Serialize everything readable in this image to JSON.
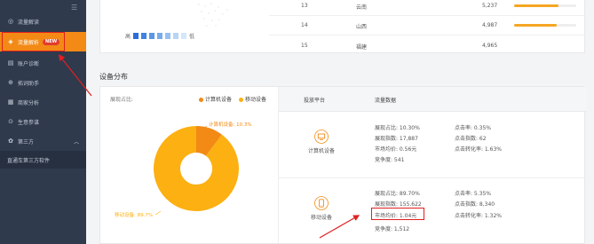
{
  "sidebar": {
    "collapse_icon": "list-icon",
    "items": [
      {
        "label": "流量解读",
        "icon": "analysis-icon"
      },
      {
        "label": "流量解析",
        "icon": "traffic-icon",
        "badge": "NEW"
      },
      {
        "label": "账户诊断",
        "icon": "diagnosis-icon"
      },
      {
        "label": "拓词助手",
        "icon": "keyword-icon"
      },
      {
        "label": "商家分析",
        "icon": "shop-icon"
      },
      {
        "label": "生意参谋",
        "icon": "business-icon"
      },
      {
        "label": "第三方",
        "icon": "plugin-icon"
      }
    ],
    "sub_item": "直通车第三方软件"
  },
  "map": {
    "scale_low": "高",
    "scale_high": "低",
    "scale_colors": [
      "#2a6fd6",
      "#3f82e0",
      "#5b97e6",
      "#78abeb",
      "#97c0f0",
      "#b7d5f5",
      "#d5e7fa"
    ]
  },
  "province_rows": [
    {
      "rank": "13",
      "name": "云南",
      "value": "5,237",
      "pct": 0.72
    },
    {
      "rank": "14",
      "name": "山西",
      "value": "4,987",
      "pct": 0.68
    },
    {
      "rank": "15",
      "name": "福建",
      "value": "4,965",
      "pct": 0.66
    }
  ],
  "device_section_title": "设备分布",
  "chart_data": {
    "type": "pie",
    "title": "",
    "legend_title": "展现占比:",
    "series": [
      {
        "name": "计算机设备",
        "value": 10.3,
        "label": "计算机设备: 10.3%",
        "color": "#f28a15"
      },
      {
        "name": "移动设备",
        "value": 89.7,
        "label": "移动设备: 89.7%",
        "color": "#fcb012"
      }
    ],
    "legend_position": "top-right"
  },
  "device_table": {
    "header_platform": "投放平台",
    "header_data": "流量数据",
    "rows": [
      {
        "platform": "计算机设备",
        "icon": "computer-icon",
        "left": [
          "展现占比: 10.30%",
          "展现指数: 17,887",
          "市场均价: 0.56元",
          "竞争度: 541"
        ],
        "right": [
          "点击率: 0.35%",
          "点击指数: 62",
          "点击转化率: 1.63%"
        ]
      },
      {
        "platform": "移动设备",
        "icon": "mobile-icon",
        "left": [
          "展现占比: 89.70%",
          "展现指数: 155,622",
          "市场均价: 1.04元",
          "竞争度: 1,512"
        ],
        "right": [
          "点击率: 5.35%",
          "点击指数: 8,340",
          "点击转化率: 1.32%"
        ]
      }
    ]
  },
  "colors": {
    "sidebar_bg": "#2f3a4d",
    "active": "#f28a15",
    "highlight_red": "#e02020"
  }
}
